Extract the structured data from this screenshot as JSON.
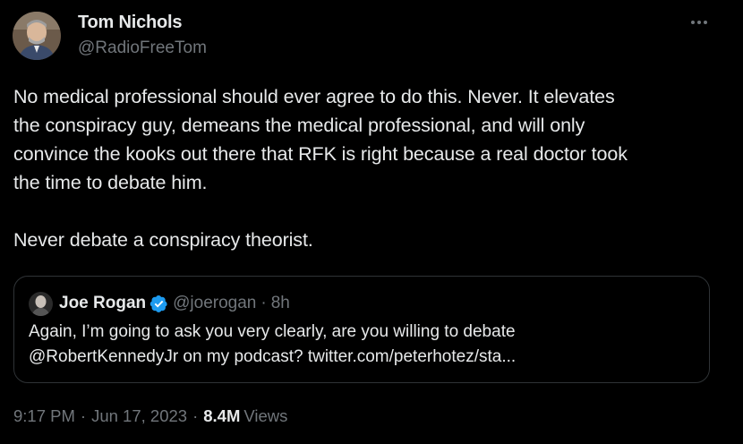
{
  "author": {
    "name": "Tom Nichols",
    "handle": "@RadioFreeTom"
  },
  "icons": {
    "more": "more-horizontal-icon",
    "verified": "verified-badge-icon"
  },
  "tweet": {
    "text": "No medical professional should ever agree to do this. Never. It elevates\nthe conspiracy guy, demeans the medical professional, and will only\nconvince the kooks out there that RFK is right because a real doctor took\nthe time to debate him.\n\nNever debate a conspiracy theorist."
  },
  "quote": {
    "name": "Joe Rogan",
    "handle": "@joerogan",
    "separator": "·",
    "time": "8h",
    "text": "Again, I’m going to ask you very clearly, are you willing to debate\n@RobertKennedyJr on my podcast? twitter.com/peterhotez/sta..."
  },
  "meta": {
    "time": "9:17 PM",
    "separator": "·",
    "date": "Jun 17, 2023",
    "views_count": "8.4M",
    "views_label": "Views"
  },
  "colors": {
    "background": "#000000",
    "text_primary": "#e7e9ea",
    "text_secondary": "#71767b",
    "border": "#2f3336",
    "verified_blue": "#1d9bf0"
  }
}
